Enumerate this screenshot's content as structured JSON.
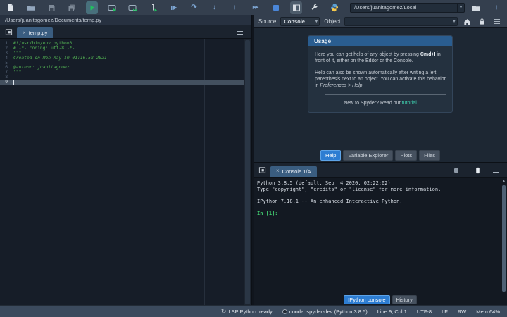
{
  "colors": {
    "toolbar_bg": "#343f4e",
    "editor_bg": "#161d28",
    "run_green": "#21c25e",
    "debug_blue": "#7ba3cf",
    "stop_blue": "#4a86d8",
    "tab_selected_blue": "#2d7dd2",
    "doc_tab_bg": "#3a5d80",
    "usage_header_blue": "#2a5d90",
    "link_teal": "#3ecfae",
    "comment_green": "#52b053",
    "prompt_green": "#40c96e",
    "statusbar_bg": "#3b4a5d",
    "current_line_bg": "#43505f"
  },
  "glyphs": {
    "close": "×",
    "combo_arrow": "▾",
    "step_curve": "↷",
    "step_into": "↓",
    "step_out": "↑",
    "continue_ff": "▶▶",
    "parent_up": "↑",
    "scroll_up": "▲",
    "refresh": "↻"
  },
  "icons": {
    "toolbar": [
      "new-file",
      "open-file",
      "save",
      "save-all",
      "run",
      "run-cell",
      "run-cell-advance",
      "run-selection",
      "debug-file",
      "debug-step",
      "debug-step-into",
      "debug-step-out",
      "debug-continue",
      "stop-debug",
      "maximize-pane",
      "preferences-wrench",
      "python-path",
      "working-directory-combobox",
      "browse-directory-folder",
      "parent-directory-up"
    ],
    "help_header": [
      "home-icon",
      "lock-icon",
      "options-menu-icon"
    ],
    "console_corner": [
      "interrupt-kernel-icon",
      "clipboard-icon",
      "options-menu-icon"
    ]
  },
  "toolbar": {
    "working_directory": "/Users/juanitagomez/Local"
  },
  "editor": {
    "breadcrumb": "/Users/juanitagomez/Documents/temp.py",
    "tab_label": "temp.py",
    "current_line": 9,
    "lines": [
      {
        "n": 1,
        "text": "#!/usr/bin/env python3",
        "italic": false
      },
      {
        "n": 2,
        "text": "# -*- coding: utf-8 -*-",
        "italic": false
      },
      {
        "n": 3,
        "text": "\"\"\"",
        "italic": true
      },
      {
        "n": 4,
        "text": "Created on Mon May 10 01:16:58 2021",
        "italic": true
      },
      {
        "n": 5,
        "text": "",
        "italic": true
      },
      {
        "n": 6,
        "text": "@author: juanitagomez",
        "italic": true
      },
      {
        "n": 7,
        "text": "\"\"\"",
        "italic": true
      },
      {
        "n": 8,
        "text": "",
        "italic": false
      },
      {
        "n": 9,
        "text": "",
        "italic": false
      }
    ]
  },
  "help": {
    "source_label": "Source",
    "source_value": "Console",
    "object_label": "Object",
    "object_value": "",
    "usage": {
      "title": "Usage",
      "para1_prefix": "Here you can get help of any object by pressing ",
      "para1_bold": "Cmd+I",
      "para1_suffix": " in front of it, either on the Editor or the Console.",
      "para2_prefix": "Help can also be shown automatically after writing a left parenthesis next to an object. You can activate this behavior in ",
      "para2_italic": "Preferences > Help",
      "para2_suffix": ".",
      "footer_text": "New to Spyder? Read our ",
      "footer_link": "tutorial"
    },
    "tabs": [
      {
        "label": "Help",
        "selected": true
      },
      {
        "label": "Variable Explorer",
        "selected": false
      },
      {
        "label": "Plots",
        "selected": false
      },
      {
        "label": "Files",
        "selected": false
      }
    ]
  },
  "console": {
    "tab_label": "Console 1/A",
    "output_lines": [
      "Python 3.8.5 (default, Sep  4 2020, 02:22:02)",
      "Type \"copyright\", \"credits\" or \"license\" for more information.",
      "",
      "IPython 7.18.1 -- An enhanced Interactive Python.",
      ""
    ],
    "prompt": "In [1]:",
    "tabs": [
      {
        "label": "IPython console",
        "selected": true
      },
      {
        "label": "History",
        "selected": false
      }
    ]
  },
  "statusbar": {
    "items": [
      {
        "icon": "lsp",
        "label": "LSP Python: ready"
      },
      {
        "icon": "conda",
        "label": "conda: spyder-dev (Python 3.8.5)"
      },
      {
        "icon": null,
        "label": "Line 9, Col 1"
      },
      {
        "icon": null,
        "label": "UTF-8"
      },
      {
        "icon": null,
        "label": "LF"
      },
      {
        "icon": null,
        "label": "RW"
      },
      {
        "icon": null,
        "label": "Mem 64%"
      }
    ]
  }
}
